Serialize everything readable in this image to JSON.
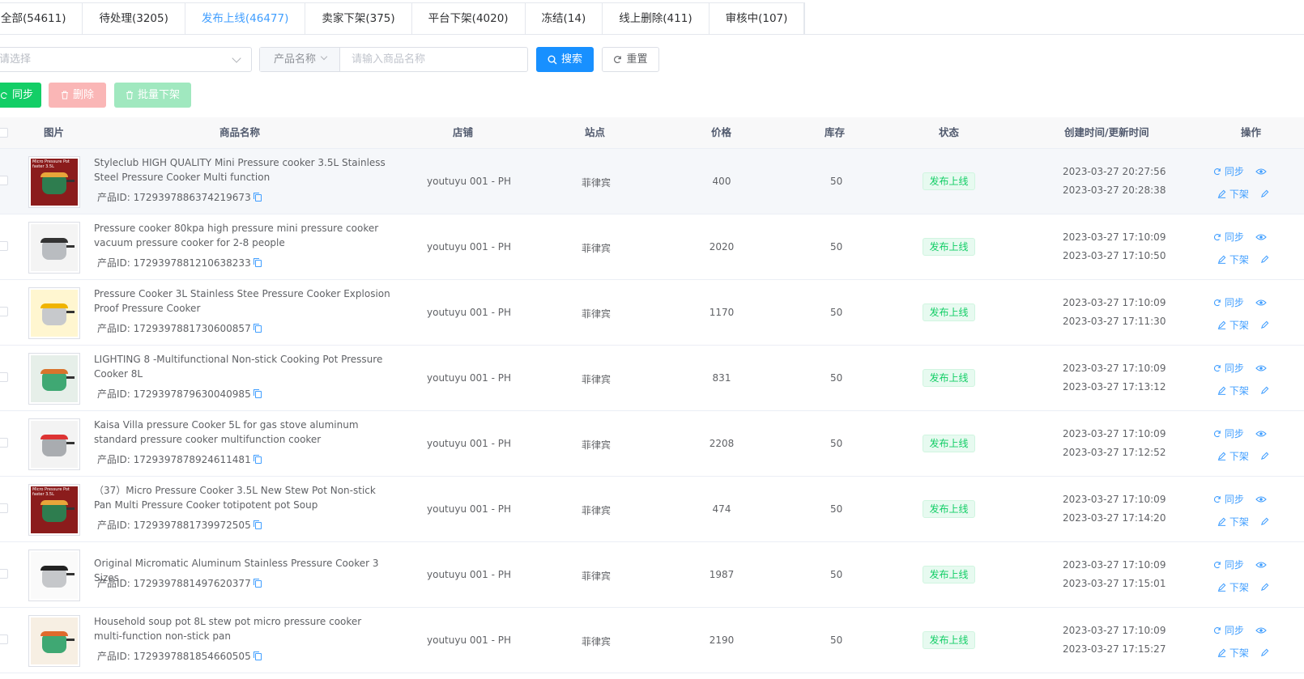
{
  "tabs": [
    {
      "label": "全部(54611)"
    },
    {
      "label": "待处理(3205)"
    },
    {
      "label": "发布上线(46477)"
    },
    {
      "label": "卖家下架(375)"
    },
    {
      "label": "平台下架(4020)"
    },
    {
      "label": "冻结(14)"
    },
    {
      "label": "线上删除(411)"
    },
    {
      "label": "审核中(107)"
    }
  ],
  "filters": {
    "select_placeholder": "请选择",
    "product_field": "产品名称",
    "product_placeholder": "请输入商品名称",
    "search": "搜索",
    "reset": "重置"
  },
  "actions": {
    "sync": "同步",
    "delete": "删除",
    "batch_offline": "批量下架"
  },
  "columns": {
    "image": "图片",
    "name": "商品名称",
    "shop": "店铺",
    "site": "站点",
    "price": "价格",
    "stock": "库存",
    "status": "状态",
    "time": "创建时间/更新时间",
    "ops": "操作"
  },
  "labels": {
    "pid_prefix": "产品ID: ",
    "op_sync": "同步",
    "op_offline": "下架"
  },
  "rows": [
    {
      "name": "Styleclub HIGH QUALITY Mini Pressure cooker 3.5L Stainless Steel Pressure Cooker Multi function",
      "pid": "1729397886374219673",
      "shop": "youtuyu 001 - PH",
      "site": "菲律宾",
      "price": "400",
      "stock": "50",
      "status": "发布上线",
      "created": "2023-03-27 20:27:56",
      "updated": "2023-03-27 20:28:38",
      "thumb_text": "Micro Pressure Pot faster 3.5L"
    },
    {
      "name": "Pressure cooker 80kpa high pressure mini pressure cooker vacuum pressure cooker for 2-8 people",
      "pid": "1729397881210638233",
      "shop": "youtuyu 001 - PH",
      "site": "菲律宾",
      "price": "2020",
      "stock": "50",
      "status": "发布上线",
      "created": "2023-03-27 17:10:09",
      "updated": "2023-03-27 17:10:50",
      "thumb_text": ""
    },
    {
      "name": "Pressure Cooker 3L Stainless Stee Pressure Cooker Explosion Proof Pressure Cooker",
      "pid": "1729397881730600857",
      "shop": "youtuyu 001 - PH",
      "site": "菲律宾",
      "price": "1170",
      "stock": "50",
      "status": "发布上线",
      "created": "2023-03-27 17:10:09",
      "updated": "2023-03-27 17:11:30",
      "thumb_text": ""
    },
    {
      "name": "LIGHTING 8 -Multifunctional Non-stick Cooking Pot Pressure Cooker 8L",
      "pid": "1729397879630040985",
      "shop": "youtuyu 001 - PH",
      "site": "菲律宾",
      "price": "831",
      "stock": "50",
      "status": "发布上线",
      "created": "2023-03-27 17:10:09",
      "updated": "2023-03-27 17:13:12",
      "thumb_text": ""
    },
    {
      "name": "Kaisa Villa pressure Cooker 5L for gas stove aluminum standard pressure cooker multifunction cooker",
      "pid": "1729397878924611481",
      "shop": "youtuyu 001 - PH",
      "site": "菲律宾",
      "price": "2208",
      "stock": "50",
      "status": "发布上线",
      "created": "2023-03-27 17:10:09",
      "updated": "2023-03-27 17:12:52",
      "thumb_text": ""
    },
    {
      "name": "（37）Micro Pressure Cooker 3.5L New Stew Pot Non-stick Pan Multi Pressure Cooker totipotent pot Soup",
      "pid": "1729397881739972505",
      "shop": "youtuyu 001 - PH",
      "site": "菲律宾",
      "price": "474",
      "stock": "50",
      "status": "发布上线",
      "created": "2023-03-27 17:10:09",
      "updated": "2023-03-27 17:14:20",
      "thumb_text": "Micro Pressure Pot faster 3.5L"
    },
    {
      "name": "Original Micromatic Aluminum Stainless Pressure Cooker 3 Sizes",
      "pid": "1729397881497620377",
      "shop": "youtuyu 001 - PH",
      "site": "菲律宾",
      "price": "1987",
      "stock": "50",
      "status": "发布上线",
      "created": "2023-03-27 17:10:09",
      "updated": "2023-03-27 17:15:01",
      "thumb_text": ""
    },
    {
      "name": "Household soup pot 8L stew pot micro pressure cooker multi-function non-stick pan",
      "pid": "1729397881854660505",
      "shop": "youtuyu 001 - PH",
      "site": "菲律宾",
      "price": "2190",
      "stock": "50",
      "status": "发布上线",
      "created": "2023-03-27 17:10:09",
      "updated": "2023-03-27 17:15:27",
      "thumb_text": ""
    }
  ],
  "colors": {
    "primary": "#1890ff",
    "success": "#13ce66",
    "danger_light": "#fab6b6",
    "success_light": "#a0e8bf",
    "link": "#409eff"
  },
  "icons": {
    "search": "search-icon",
    "reset": "refresh-icon",
    "sync": "sync-icon",
    "delete": "trash-icon",
    "batch": "trash-icon",
    "view": "eye-icon",
    "edit": "edit-icon",
    "copy": "copy-icon",
    "dropdown": "chevron-down-icon"
  }
}
